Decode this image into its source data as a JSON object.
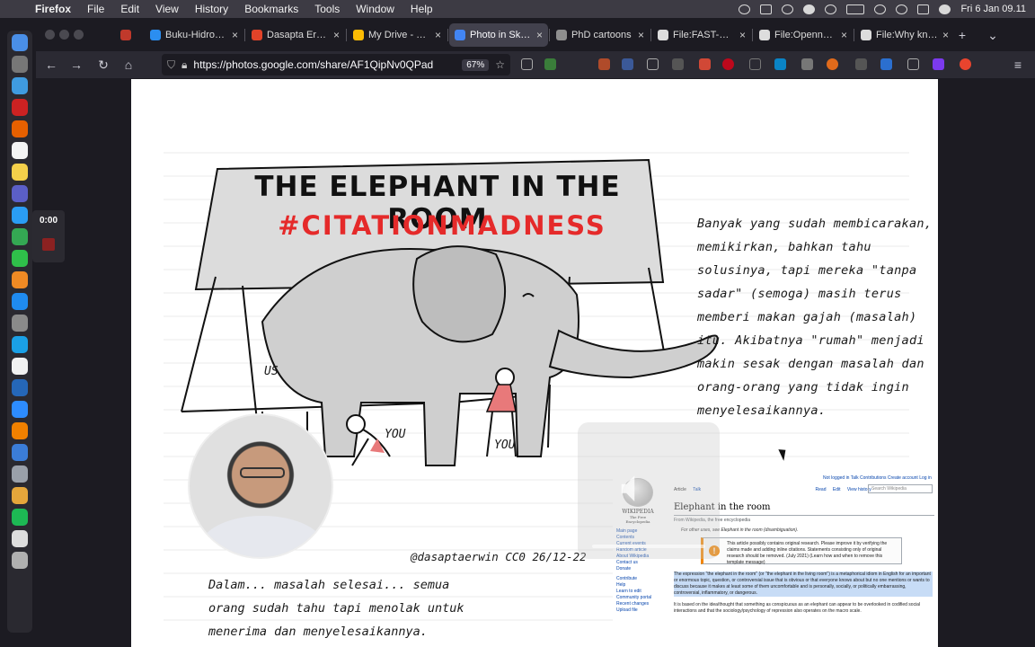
{
  "menubar": {
    "app_name": "Firefox",
    "menus": [
      "File",
      "Edit",
      "View",
      "History",
      "Bookmarks",
      "Tools",
      "Window",
      "Help"
    ],
    "datetime": "Fri 6 Jan  09.11",
    "status_icons": [
      "screen-record-icon",
      "text-input-icon",
      "accessibility-icon",
      "settings-icon",
      "bluetooth-icon",
      "battery-icon",
      "wifi-icon",
      "search-icon",
      "control-center-icon",
      "user-icon"
    ]
  },
  "dock": {
    "apps": [
      {
        "name": "chrome-app",
        "color": "#4a8fe7"
      },
      {
        "name": "screenshot-app",
        "color": "#777777"
      },
      {
        "name": "launchpad-app",
        "color": "#3f9be0"
      },
      {
        "name": "opera-app",
        "color": "#cc2222"
      },
      {
        "name": "firefox-app",
        "color": "#e66000"
      },
      {
        "name": "calendar-app",
        "color": "#f4f4f4"
      },
      {
        "name": "notes-app",
        "color": "#f4d04a"
      },
      {
        "name": "teams-app",
        "color": "#5b5fc7"
      },
      {
        "name": "finder-app",
        "color": "#2a9df4"
      },
      {
        "name": "sheets-app",
        "color": "#34a853"
      },
      {
        "name": "numbers-app",
        "color": "#2fbf4a"
      },
      {
        "name": "pages-app",
        "color": "#f08a24"
      },
      {
        "name": "appstore-app",
        "color": "#1f8bf0"
      },
      {
        "name": "settings-app",
        "color": "#8a8a8a"
      },
      {
        "name": "skype-app",
        "color": "#1aa0e6"
      },
      {
        "name": "notion-app",
        "color": "#f1f1f1"
      },
      {
        "name": "r-app",
        "color": "#2567b8"
      },
      {
        "name": "zoom-app",
        "color": "#2d8cff"
      },
      {
        "name": "vlc-app",
        "color": "#f08000"
      },
      {
        "name": "network-app",
        "color": "#3b7dd8"
      },
      {
        "name": "storage-app",
        "color": "#9aa0aa"
      },
      {
        "name": "photos-app",
        "color": "#e5a63b"
      },
      {
        "name": "spotify-app",
        "color": "#1db954"
      },
      {
        "name": "preview-app",
        "color": "#dddddd"
      },
      {
        "name": "trash-app",
        "color": "#b0b0b0"
      }
    ]
  },
  "recording": {
    "time": "0:00"
  },
  "tabs": [
    {
      "title": "",
      "favicon_color": "#c0392b",
      "pinned": true
    },
    {
      "title": "Buku-Hidrogeo",
      "favicon_color": "#2b8ef0"
    },
    {
      "title": "Dasapta Erwin",
      "favicon_color": "#e24329"
    },
    {
      "title": "My Drive - Goog",
      "favicon_color": "#fbbc04"
    },
    {
      "title": "Photo in Sketch",
      "favicon_color": "#4285f4",
      "active": true
    },
    {
      "title": "PhD cartoons",
      "favicon_color": "#8e8e8e"
    },
    {
      "title": "File:FAST-SLOW",
      "favicon_color": "#dddddd"
    },
    {
      "title": "File:Openness-",
      "favicon_color": "#dddddd"
    },
    {
      "title": "File:Why knowle",
      "favicon_color": "#dddddd"
    }
  ],
  "navbar": {
    "url": "https://photos.google.com/share/AF1QipNv0QPad",
    "zoom": "67%"
  },
  "sketch": {
    "banner_title": "THE ELEPHANT IN THE ROOM",
    "banner_tag": "#CITATIONMADNESS",
    "label_us": "US",
    "label_you_1": "YOU",
    "label_you_2": "YOU",
    "credit": "@dasaptaerwin CC0 26/12-22",
    "indo_text": "Banyak yang sudah membicarakan, memikirkan, bahkan tahu solusinya, tapi mereka \"tanpa sadar\" (semoga) masih terus memberi makan gajah (masalah) itu. Akibatnya \"rumah\" menjadi makin sesak dengan masalah dan orang-orang yang tidak ingin menyelesaikannya.",
    "bottom_text": "Dalam... masalah selesai... semua orang sudah tahu tapi menolak untuk menerima dan menyelesaikannya."
  },
  "wikipedia": {
    "personal_tools": "Not logged in  Talk  Contributions  Create account  Log in",
    "tab_article": "Article",
    "tab_talk": "Talk",
    "tab_read": "Read",
    "tab_edit": "Edit",
    "tab_history": "View history",
    "search_placeholder": "Search Wikipedia",
    "logo_text": "WIKIPEDIA",
    "logo_sub": "The Free Encyclopedia",
    "title": "Elephant in the room",
    "from": "From Wikipedia, the free encyclopedia",
    "hatnote": "For other uses, see Elephant in the room (disambiguation).",
    "notice": "This article possibly contains original research. Please improve it by verifying the claims made and adding inline citations. Statements consisting only of original research should be removed. (July 2021) (Learn how and when to remove this template message)",
    "lead": "The expression \"the elephant in the room\" (or \"the elephant in the living room\") is a metaphorical idiom in English for an important or enormous topic, question, or controversial issue that is obvious or that everyone knows about but no one mentions or wants to discuss because it makes at least some of them uncomfortable and is personally, socially, or politically embarrassing, controversial, inflammatory, or dangerous.",
    "lead2": "It is based on the idea/thought that something as conspicuous as an elephant can appear to be overlooked in codified social interactions and that the sociology/psychology of repression also operates on the macro scale.",
    "sidebar": [
      "Main page",
      "Contents",
      "Current events",
      "Random article",
      "About Wikipedia",
      "Contact us",
      "Donate",
      "",
      "Contribute",
      "Help",
      "Learn to edit",
      "Community portal",
      "Recent changes",
      "Upload file"
    ]
  }
}
